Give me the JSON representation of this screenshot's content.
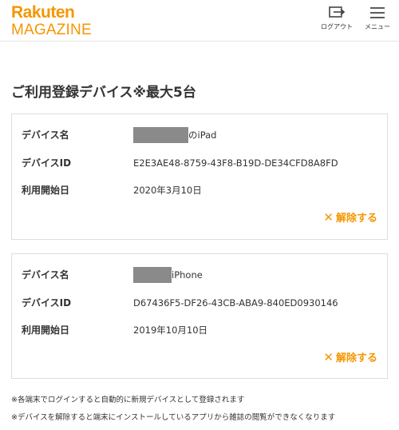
{
  "header": {
    "logo_top": "Rakuten",
    "logo_bottom": "MAGAZINE",
    "logout_label": "ログアウト",
    "menu_label": "メニュー",
    "brand_color": "#f59600"
  },
  "page": {
    "title": "ご利用登録デバイス※最大5台"
  },
  "devices": [
    {
      "name_label": "デバイス名",
      "name_value": "のiPad",
      "id_label": "デバイスID",
      "id_value": "E2E3AE48-8759-43F8-B19D-DE34CFD8A8FD",
      "date_label": "利用開始日",
      "date_value": "2020年3月10日",
      "cancel_label": "解除する"
    },
    {
      "name_label": "デバイス名",
      "name_value": "iPhone",
      "id_label": "デバイスID",
      "id_value": "D67436F5-DF26-43CB-ABA9-840ED0930146",
      "date_label": "利用開始日",
      "date_value": "2019年10月10日",
      "cancel_label": "解除する"
    }
  ],
  "notes": [
    "※各端末でログインすると自動的に新規デバイスとして登録されます",
    "※デバイスを解除すると端末にインストールしているアプリから雑誌の閲覧ができなくなります"
  ],
  "icons": {
    "logout": "logout-icon",
    "menu": "hamburger-menu-icon",
    "cancel": "close-x-icon"
  }
}
